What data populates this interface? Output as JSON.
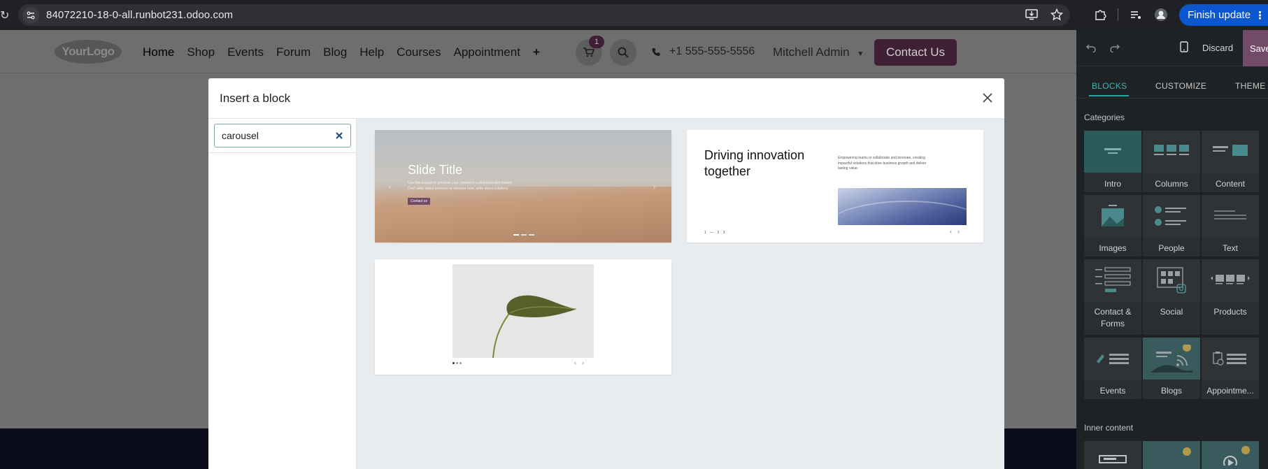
{
  "browser": {
    "url": "84072210-18-0-all.runbot231.odoo.com",
    "finish_update_label": "Finish update"
  },
  "site": {
    "logo_text": "YourLogo",
    "nav": [
      "Home",
      "Shop",
      "Events",
      "Forum",
      "Blog",
      "Help",
      "Courses",
      "Appointment"
    ],
    "cart_count": "1",
    "phone": "+1 555-555-5556",
    "user": "Mitchell Admin",
    "contact_button": "Contact Us"
  },
  "modal": {
    "title": "Insert a block",
    "search_value": "carousel",
    "snippets": [
      {
        "title": "Slide Title",
        "body": "Use this snippet to presents your content in a slideshow-like format. Don't write about products or services here, write about solutions.",
        "button": "Contact us"
      },
      {
        "title": "Driving innovation together",
        "body": "Empowering teams to collaborate and innovate, creating impactful solutions that drive business growth and deliver lasting value.",
        "pager": "1 — 2 3"
      },
      {}
    ]
  },
  "editor": {
    "discard_label": "Discard",
    "save_label": "Save",
    "tabs": [
      "BLOCKS",
      "CUSTOMIZE",
      "THEME"
    ],
    "active_tab": "BLOCKS",
    "categories_heading": "Categories",
    "categories": [
      "Intro",
      "Columns",
      "Content",
      "Images",
      "People",
      "Text",
      "Contact & Forms",
      "Social",
      "Products",
      "Events",
      "Blogs",
      "Appointme..."
    ],
    "inner_content_heading": "Inner content"
  },
  "colors": {
    "accent_teal": "#2ea6a6",
    "brand_purple": "#714b67",
    "browser_blue": "#0b57d0"
  }
}
